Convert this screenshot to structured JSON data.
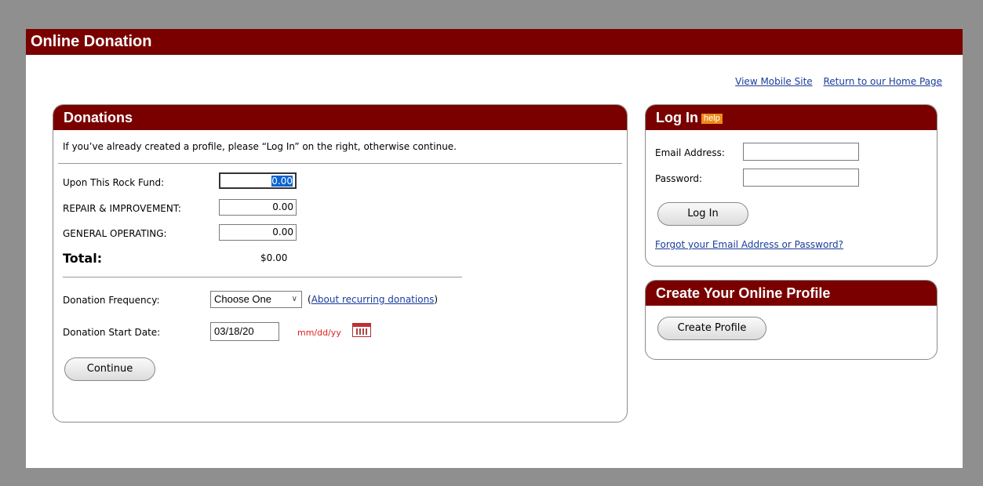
{
  "header": {
    "title": "Online Donation"
  },
  "toplinks": {
    "mobile": "View Mobile Site",
    "home": "Return to our Home Page"
  },
  "donations": {
    "title": "Donations",
    "intro": "If you’ve already created a profile, please “Log In” on the right, otherwise continue.",
    "funds": [
      {
        "label": "Upon This Rock Fund:",
        "value": "0.00"
      },
      {
        "label": "REPAIR & IMPROVEMENT:",
        "value": "0.00"
      },
      {
        "label": "GENERAL OPERATING:",
        "value": "0.00"
      }
    ],
    "total_label": "Total:",
    "total_value": "$0.00",
    "frequency_label": "Donation Frequency:",
    "frequency_value": "Choose One",
    "recurring_open": "(",
    "recurring_link": "About recurring donations",
    "recurring_close": ")",
    "start_label": "Donation Start Date:",
    "start_value": "03/18/20",
    "date_hint": "mm/dd/yy",
    "continue_label": "Continue"
  },
  "login": {
    "title": "Log In",
    "help": "help",
    "email_label": "Email Address:",
    "password_label": "Password:",
    "button_label": "Log In",
    "forgot_link": "Forgot your Email Address or Password?"
  },
  "profile": {
    "title": "Create Your Online Profile",
    "button_label": "Create Profile"
  },
  "colors": {
    "brand": "#7a0000",
    "link": "#1a3c9c",
    "hint": "#e02020",
    "help": "#f08a1a"
  },
  "icons": {
    "calendar": "calendar-icon",
    "dropdown": "chevron-down-icon"
  }
}
